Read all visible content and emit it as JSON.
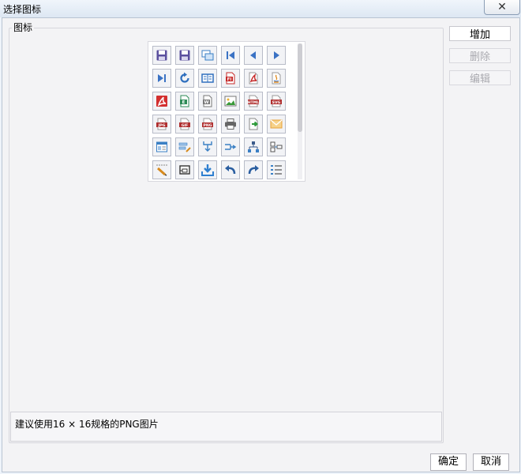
{
  "window": {
    "title": "选择图标",
    "close_glyph": "✕"
  },
  "group": {
    "label": "图标"
  },
  "icons": [
    {
      "name": "save-icon",
      "color": "#5a4f9e",
      "kind": "floppy"
    },
    {
      "name": "save-as-icon",
      "color": "#5a4f9e",
      "kind": "floppy"
    },
    {
      "name": "save-multiple-icon",
      "color": "#3a7fc4",
      "kind": "multi"
    },
    {
      "name": "first-record-icon",
      "color": "#3a72c4",
      "kind": "first"
    },
    {
      "name": "previous-record-icon",
      "color": "#3a72c4",
      "kind": "prev"
    },
    {
      "name": "next-record-icon",
      "color": "#3a72c4",
      "kind": "next"
    },
    {
      "name": "last-record-icon",
      "color": "#3a72c4",
      "kind": "last"
    },
    {
      "name": "refresh-icon",
      "color": "#2f6fbe",
      "kind": "refresh"
    },
    {
      "name": "book-icon",
      "color": "#2f6fbe",
      "kind": "book"
    },
    {
      "name": "export-flash-icon",
      "color": "#c62828",
      "kind": "doc",
      "text": "Fl"
    },
    {
      "name": "export-pdf-icon",
      "color": "#c62828",
      "kind": "pdf"
    },
    {
      "name": "export-java-icon",
      "color": "#e08a1e",
      "kind": "java"
    },
    {
      "name": "pdf-file-icon",
      "color": "#d32f2f",
      "kind": "pdfbig"
    },
    {
      "name": "excel-file-icon",
      "color": "#2e8b57",
      "kind": "doc",
      "text": "E"
    },
    {
      "name": "word-file-icon",
      "color": "#777777",
      "kind": "doc",
      "text": "W"
    },
    {
      "name": "image-file-icon",
      "color": "#3a9a3a",
      "kind": "image"
    },
    {
      "name": "html-file-icon",
      "color": "#b03030",
      "kind": "tag",
      "text": "HTML"
    },
    {
      "name": "svg-file-icon",
      "color": "#b03030",
      "kind": "tag",
      "text": "SVG"
    },
    {
      "name": "jpg-file-icon",
      "color": "#b03030",
      "kind": "tag",
      "text": "JPG"
    },
    {
      "name": "gif-file-icon",
      "color": "#b03030",
      "kind": "tag",
      "text": "GIF"
    },
    {
      "name": "png-file-icon",
      "color": "#b03030",
      "kind": "tag",
      "text": "PNG"
    },
    {
      "name": "print-icon",
      "color": "#666666",
      "kind": "print"
    },
    {
      "name": "export-icon",
      "color": "#2e9b3a",
      "kind": "export"
    },
    {
      "name": "mail-icon",
      "color": "#e8a23a",
      "kind": "mail"
    },
    {
      "name": "form-icon",
      "color": "#3a7fc4",
      "kind": "form"
    },
    {
      "name": "edit-list-icon",
      "color": "#3a7fc4",
      "kind": "editlist"
    },
    {
      "name": "merge-down-icon",
      "color": "#3a7fc4",
      "kind": "mergedown"
    },
    {
      "name": "branch-right-icon",
      "color": "#3a7fc4",
      "kind": "branchright"
    },
    {
      "name": "hierarchy-icon",
      "color": "#3a5a8a",
      "kind": "hier"
    },
    {
      "name": "layout-icon",
      "color": "#555555",
      "kind": "layout"
    },
    {
      "name": "pencil-icon",
      "color": "#d68a1e",
      "kind": "pencil"
    },
    {
      "name": "link-icon",
      "color": "#333333",
      "kind": "linkbox"
    },
    {
      "name": "download-icon",
      "color": "#2f7fd0",
      "kind": "download"
    },
    {
      "name": "undo-icon",
      "color": "#2a5ea0",
      "kind": "undo"
    },
    {
      "name": "redo-icon",
      "color": "#2a5ea0",
      "kind": "redo"
    },
    {
      "name": "list-icon",
      "color": "#3a7fc4",
      "kind": "list"
    }
  ],
  "hint": "建议使用16 × 16规格的PNG图片",
  "buttons": {
    "add": "增加",
    "delete": "删除",
    "edit": "编辑",
    "ok": "确定",
    "cancel": "取消"
  }
}
